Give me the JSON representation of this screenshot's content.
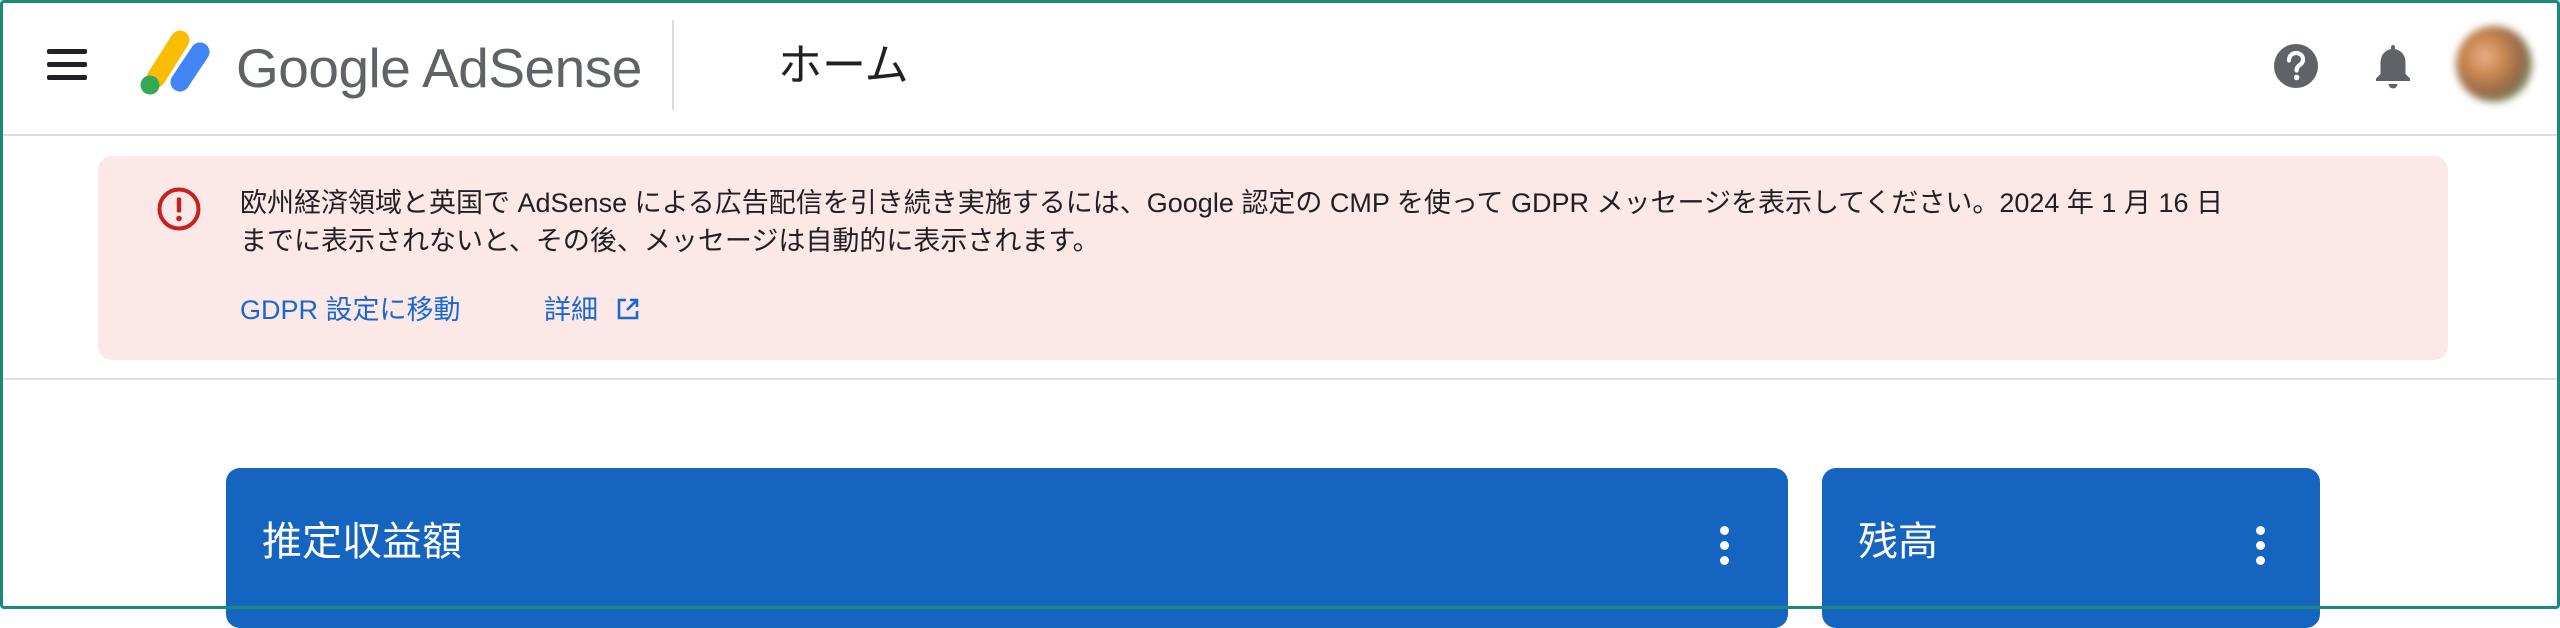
{
  "app": {
    "brand": "Google AdSense",
    "page_title": "ホーム"
  },
  "alert": {
    "message_line1": "欧州経済領域と英国で AdSense による広告配信を引き続き実施するには、Google 認定の CMP を使って GDPR メッセージを表示してください。2024 年 1 月 16 日",
    "message_line2": "までに表示されないと、その後、メッセージは自動的に表示されます。",
    "gdpr_link": "GDPR 設定に移動",
    "details_link": "詳細"
  },
  "cards": {
    "earnings_title": "推定収益額",
    "balance_title": "残高"
  },
  "icons": {
    "menu": "menu-icon",
    "logo": "adsense-logo-icon",
    "help": "help-icon",
    "notifications": "bell-icon",
    "alert": "error-icon",
    "external": "open-in-new-icon",
    "more": "more-vert-icon"
  },
  "colors": {
    "alert_background": "#fce8e6",
    "alert_icon": "#c5221f",
    "link": "#1967d2",
    "card_background": "#1565c0",
    "logo_yellow": "#fbbc04",
    "logo_blue": "#4285f4",
    "logo_green": "#34a853"
  }
}
